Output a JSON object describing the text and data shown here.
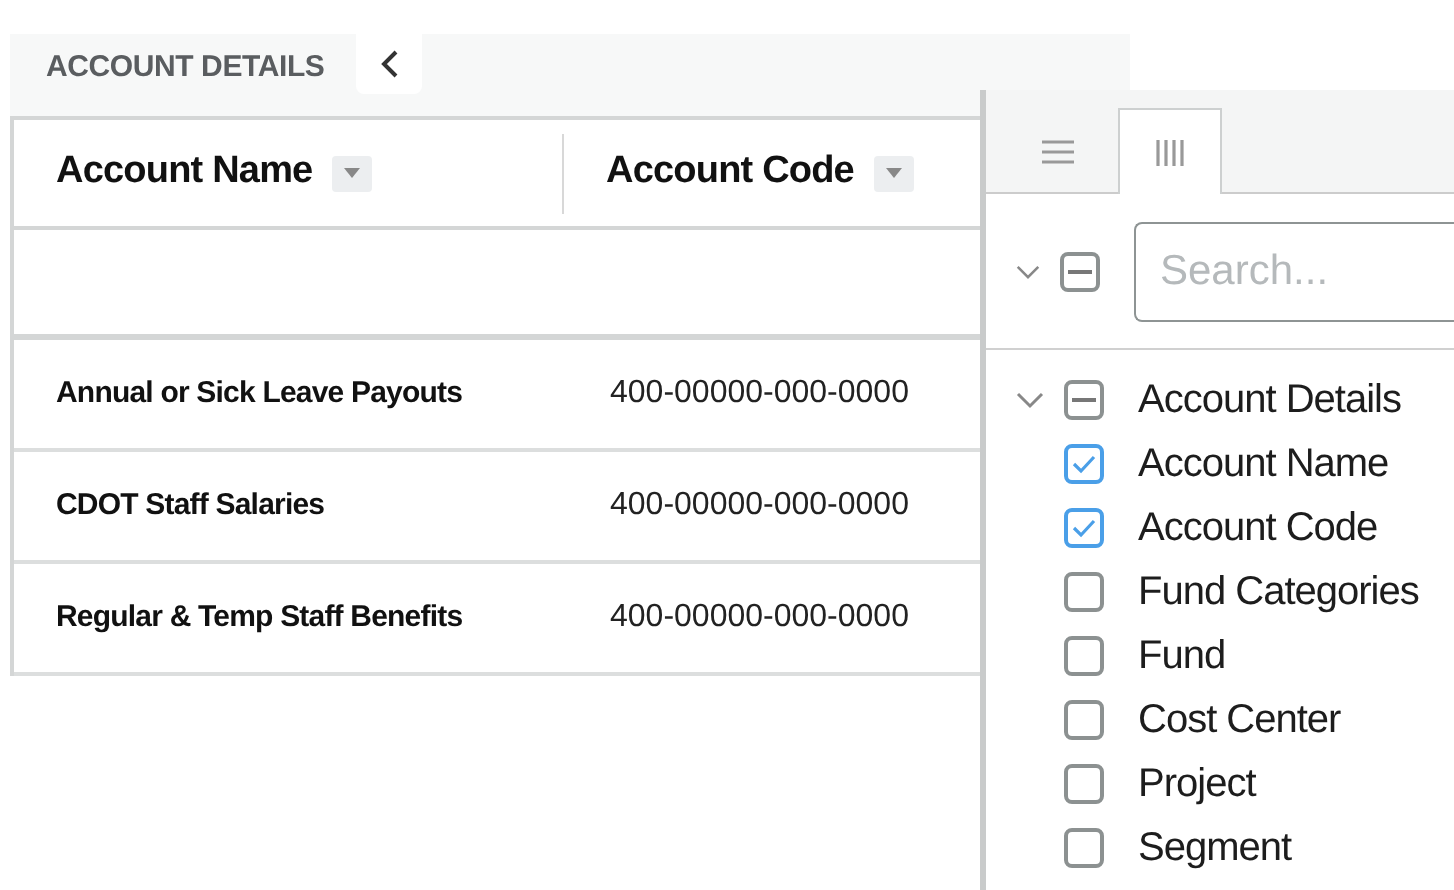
{
  "panel_header": {
    "title": "ACCOUNT DETAILS"
  },
  "table": {
    "columns": [
      {
        "label": "Account Name"
      },
      {
        "label": "Account Code"
      }
    ],
    "rows": [
      {
        "name": "Annual or Sick Leave Payouts",
        "code": "400-00000-000-0000"
      },
      {
        "name": "CDOT Staff Salaries",
        "code": "400-00000-000-0000"
      },
      {
        "name": "Regular & Temp Staff Benefits",
        "code": "400-00000-000-0000"
      }
    ]
  },
  "tool_panel": {
    "tabs": [
      {
        "kind": "menu",
        "selected": false
      },
      {
        "kind": "columns",
        "selected": true
      }
    ],
    "select_all": {
      "indeterminate": true,
      "expanded": true
    },
    "search": {
      "placeholder": "Search..."
    },
    "tree": [
      {
        "label": "Account Details",
        "indeterminate": true,
        "expanded": true,
        "children": [
          {
            "label": "Account Name",
            "checked": true
          },
          {
            "label": "Account Code",
            "checked": true
          },
          {
            "label": "Fund Categories",
            "checked": false
          },
          {
            "label": "Fund",
            "checked": false
          },
          {
            "label": "Cost Center",
            "checked": false
          },
          {
            "label": "Project",
            "checked": false
          },
          {
            "label": "Segment",
            "checked": false
          }
        ]
      }
    ]
  }
}
